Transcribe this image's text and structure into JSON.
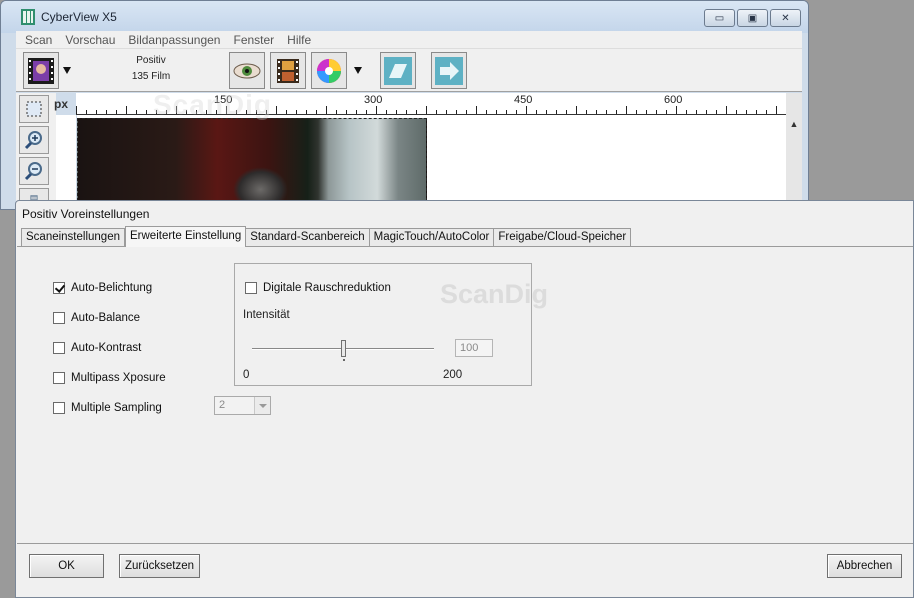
{
  "main_window": {
    "title": "CyberView X5",
    "menu": [
      "Scan",
      "Vorschau",
      "Bildanpassungen",
      "Fenster",
      "Hilfe"
    ],
    "film_mode": {
      "line1": "Positiv",
      "line2": "135 Film"
    },
    "ruler": {
      "unit": "px",
      "ticks": [
        "150",
        "300",
        "450",
        "600"
      ]
    },
    "watermark": "ScanDig"
  },
  "dialog": {
    "title": "Positiv Voreinstellungen",
    "tabs": [
      {
        "label": "Scaneinstellungen",
        "active": false
      },
      {
        "label": "Erweiterte Einstellung",
        "active": true
      },
      {
        "label": "Standard-Scanbereich",
        "active": false
      },
      {
        "label": "MagicTouch/AutoColor",
        "active": false
      },
      {
        "label": "Freigabe/Cloud-Speicher",
        "active": false
      }
    ],
    "watermark": "ScanDig",
    "options": [
      {
        "label": "Auto-Belichtung",
        "checked": true
      },
      {
        "label": "Auto-Balance",
        "checked": false
      },
      {
        "label": "Auto-Kontrast",
        "checked": false
      },
      {
        "label": "Multipass Xposure",
        "checked": false
      },
      {
        "label": "Multiple Sampling",
        "checked": false
      }
    ],
    "multiple_sampling_value": "2",
    "noise_reduction": {
      "label": "Digitale Rauschreduktion",
      "checked": false,
      "intensity_label": "Intensität",
      "value": "100",
      "min": "0",
      "max": "200",
      "slider_fraction": 0.5
    },
    "buttons": {
      "ok": "OK",
      "reset": "Zurücksetzen",
      "cancel": "Abbrechen"
    }
  }
}
